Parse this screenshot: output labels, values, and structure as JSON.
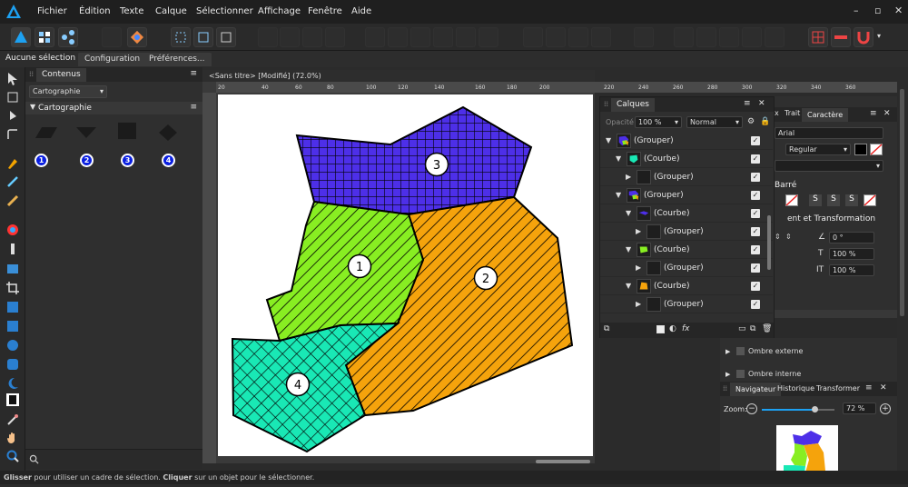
{
  "menubar": {
    "items": [
      "Fichier",
      "Édition",
      "Texte",
      "Calque",
      "Sélectionner",
      "Affichage",
      "Fenêtre",
      "Aide"
    ],
    "window_controls": [
      "–",
      "▫",
      "✕"
    ]
  },
  "context": {
    "selection_label": "Aucune sélection",
    "tabs": [
      "Configuration",
      "Préférences..."
    ]
  },
  "contents_panel": {
    "tab": "Contenus",
    "dropdown": "Cartographie",
    "category": "Cartographie",
    "markers": [
      "1",
      "2",
      "3",
      "4"
    ]
  },
  "document": {
    "tab_title": "<Sans titre> [Modifié] (72.0%)",
    "ruler_h_labels": [
      "20",
      "40",
      "60",
      "80",
      "100",
      "120",
      "140",
      "160",
      "180",
      "200"
    ],
    "ruler_h_right_labels": [
      "220",
      "240",
      "260",
      "280",
      "300",
      "320",
      "340",
      "360"
    ],
    "region_labels": [
      "1",
      "2",
      "3",
      "4"
    ]
  },
  "layers_panel": {
    "tab": "Calques",
    "opacity_label": "Opacité",
    "opacity_value": "100 %",
    "blend_mode": "Normal",
    "rows": [
      {
        "indent": 0,
        "tri": "▼",
        "name": "(Grouper)"
      },
      {
        "indent": 1,
        "tri": "▼",
        "name": "(Courbe)"
      },
      {
        "indent": 2,
        "tri": "▶",
        "name": "(Grouper)"
      },
      {
        "indent": 1,
        "tri": "▼",
        "name": "(Grouper)"
      },
      {
        "indent": 2,
        "tri": "▼",
        "name": "(Courbe)"
      },
      {
        "indent": 3,
        "tri": "▶",
        "name": "(Grouper)"
      },
      {
        "indent": 2,
        "tri": "▼",
        "name": "(Courbe)"
      },
      {
        "indent": 3,
        "tri": "▶",
        "name": "(Grouper)"
      },
      {
        "indent": 2,
        "tri": "▼",
        "name": "(Courbe)"
      },
      {
        "indent": 3,
        "tri": "▶",
        "name": "(Grouper)"
      }
    ],
    "footer_fx": "fx"
  },
  "character_panel": {
    "tabs": [
      "x",
      "Trait",
      "Caractère"
    ],
    "font": "Arial",
    "style": "Regular",
    "section_strike": "Barré",
    "section_transform": "ent et Transformation",
    "rotation": "0 °",
    "scale_v": "100 %",
    "scale_h": "100 %"
  },
  "effects": {
    "items": [
      "Ombre externe",
      "Ombre interne"
    ]
  },
  "navigator": {
    "tabs": [
      "Navigateur",
      "Historique",
      "Transformer"
    ],
    "zoom_label": "Zoom:",
    "zoom_value": "72 %",
    "zoom_fraction": 0.72
  },
  "statusbar": {
    "bold1": "Glisser",
    "text1": " pour utiliser un cadre de sélection. ",
    "bold2": "Cliquer",
    "text2": " sur un objet pour le sélectionner."
  },
  "colors": {
    "region1": "#88ee22",
    "region2": "#f5a30c",
    "region3": "#4d2fe8",
    "region4": "#19e8b5",
    "accent": "#0a1fe0"
  }
}
